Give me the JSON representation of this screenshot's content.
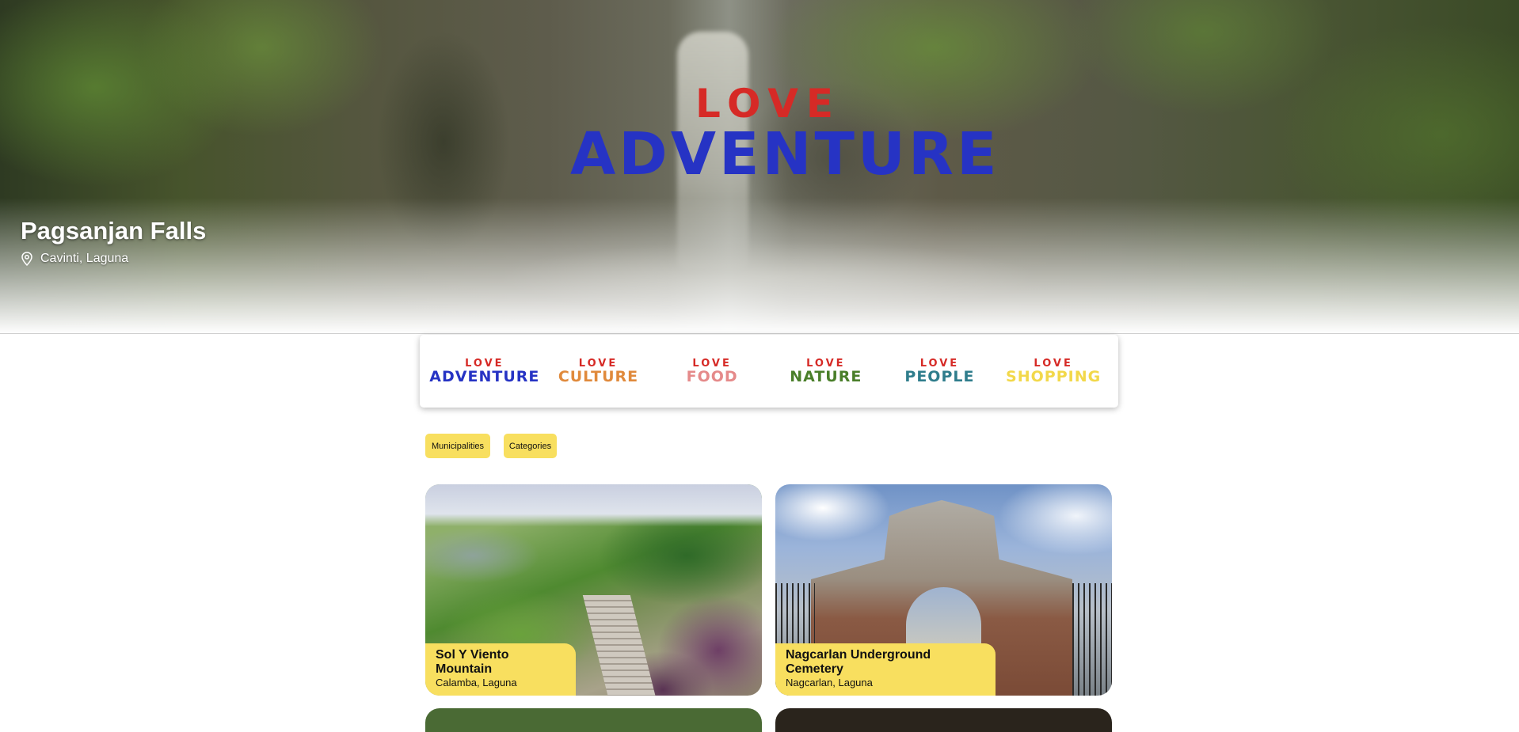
{
  "hero": {
    "logo_love": "LOVE",
    "logo_word": "ADVENTURE",
    "title": "Pagsanjan Falls",
    "location": "Cavinti, Laguna",
    "logo_colors": {
      "love": "#d62a26",
      "word": "#2633c4"
    }
  },
  "categories": [
    {
      "love": "LOVE",
      "word": "ADVENTURE",
      "color": "#2633c4"
    },
    {
      "love": "LOVE",
      "word": "CULTURE",
      "color": "#e08a3c"
    },
    {
      "love": "LOVE",
      "word": "FOOD",
      "color": "#e58a8a"
    },
    {
      "love": "LOVE",
      "word": "NATURE",
      "color": "#4a7f2a"
    },
    {
      "love": "LOVE",
      "word": "PEOPLE",
      "color": "#2f7d8c"
    },
    {
      "love": "LOVE",
      "word": "SHOPPING",
      "color": "#f2d84a"
    }
  ],
  "filters": {
    "municipalities": "Municipalities",
    "categories": "Categories"
  },
  "cards": [
    {
      "title": "Sol Y Viento Mountain",
      "location": "Calamba, Laguna"
    },
    {
      "title": "Nagcarlan Underground Cemetery",
      "location": "Nagcarlan, Laguna"
    }
  ],
  "colors": {
    "accent_yellow": "#f8df5f"
  }
}
